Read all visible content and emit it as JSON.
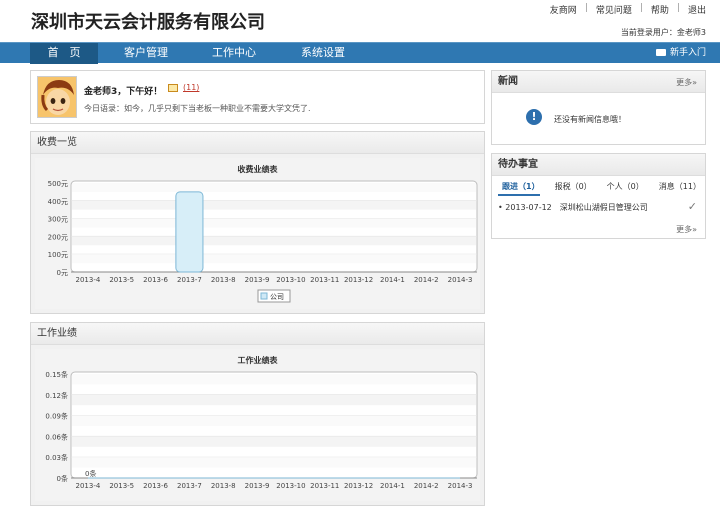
{
  "header": {
    "logo": "深圳市天云会计服务有限公司",
    "links": [
      "友商网",
      "常见问题",
      "帮助",
      "退出"
    ],
    "current_user": "当前登录用户：金老师3"
  },
  "nav": {
    "items": [
      "首　页",
      "客户管理",
      "工作中心",
      "系统设置"
    ],
    "active": 0,
    "guide": "新手入门"
  },
  "welcome": {
    "greeting": "金老师3，下午好！",
    "mail_count": "(11)",
    "quote": "今日语录：如今，几乎只剩下当老板一种职业不需要大学文凭了."
  },
  "fee_panel": {
    "title": "收费一览",
    "chart_data": {
      "type": "bar",
      "title": "收费业绩表",
      "categories": [
        "2013-4",
        "2013-5",
        "2013-6",
        "2013-7",
        "2013-8",
        "2013-9",
        "2013-10",
        "2013-11",
        "2013-12",
        "2014-1",
        "2014-2",
        "2014-3"
      ],
      "series": [
        {
          "name": "公司",
          "values": [
            0,
            0,
            0,
            450,
            0,
            0,
            0,
            0,
            0,
            0,
            0,
            0
          ]
        }
      ],
      "y_ticks": [
        "0元",
        "100元",
        "200元",
        "300元",
        "400元",
        "500元"
      ],
      "ylim": [
        0,
        500
      ],
      "grid": true,
      "legend": "bottom-center"
    }
  },
  "work_panel": {
    "title": "工作业绩",
    "chart_data": {
      "type": "line",
      "title": "工作业绩表",
      "categories": [
        "2013-4",
        "2013-5",
        "2013-6",
        "2013-7",
        "2013-8",
        "2013-9",
        "2013-10",
        "2013-11",
        "2013-12",
        "2014-1",
        "2014-2",
        "2014-3"
      ],
      "series": [
        {
          "values": [
            0,
            0,
            0,
            0,
            0,
            0,
            0,
            0,
            0,
            0,
            0,
            0
          ]
        }
      ],
      "data_labels": [
        "0条"
      ],
      "y_ticks": [
        "0条",
        "0.03条",
        "0.06条",
        "0.09条",
        "0.12条",
        "0.15条"
      ],
      "ylim": [
        0,
        0.15
      ],
      "grid": true
    }
  },
  "news": {
    "title": "新闻",
    "more": "更多»",
    "empty_text": "还没有新闻信息哦！"
  },
  "todo": {
    "title": "待办事宜",
    "tabs": [
      "跟进（1）",
      "报税（0）",
      "个人（0）",
      "消息（11）"
    ],
    "row_date": "• 2013-07-12",
    "row_company": "深圳松山湖假日管理公司",
    "more": "更多»"
  },
  "colors": {
    "nav_bg": "#2f78b2",
    "nav_active": "#1d5986",
    "bar_fill": "#cfe9f6"
  }
}
